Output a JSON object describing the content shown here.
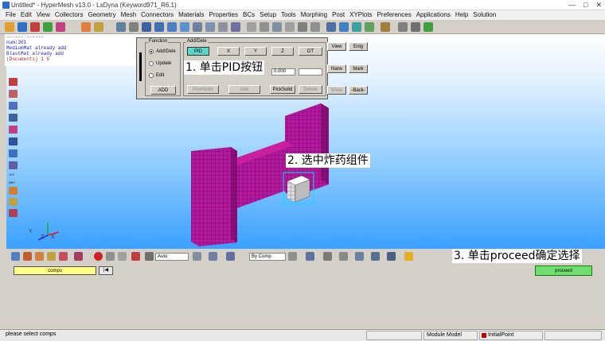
{
  "window": {
    "title": "Untitled* - HyperMesh v13.0 - LsDyna (Keyword971_R6.1)"
  },
  "menu": [
    "File",
    "Edit",
    "View",
    "Collectors",
    "Geometry",
    "Mesh",
    "Connectors",
    "Materials",
    "Properties",
    "BCs",
    "Setup",
    "Tools",
    "Morphing",
    "Post",
    "XYPlots",
    "Preferences",
    "Applications",
    "Help",
    "Solution"
  ],
  "console": {
    "lines": [
      "------  ------",
      "num:301",
      "MediumMat already add",
      "BlastMat already add",
      "(Documents) 1 6"
    ]
  },
  "panel": {
    "function_legend": "Function",
    "radios": [
      {
        "label": "Add/Dele",
        "selected": true
      },
      {
        "label": "Update",
        "selected": false
      },
      {
        "label": "Edit",
        "selected": false
      }
    ],
    "add_button": "ADD",
    "adddele_legend": "Add/Dele",
    "tabs": [
      "PID",
      "X",
      "Y",
      "Z",
      "DT"
    ],
    "active_tab": "PID",
    "value": "0.000",
    "row_buttons": [
      "PickNode",
      "Add",
      "PickSolid",
      "Delete"
    ],
    "right_buttons": [
      "View",
      "Enlg",
      "Narw",
      "Mark",
      "Show",
      "-Back-"
    ]
  },
  "annotations": {
    "step1": "1. 单击PID按钮",
    "step2": "2. 选中炸药组件",
    "step3": "3. 单击proceed确定选择"
  },
  "axis": {
    "y": "Y",
    "z": "Z",
    "x": "X"
  },
  "bottom_toolbar": {
    "auto_combo": "Auto",
    "bycomp_combo": "By Comp"
  },
  "selection": {
    "comps_button": "comps",
    "reset_icon": "|◀",
    "proceed_button": "proceed"
  },
  "status": {
    "message": "please select comps",
    "module": "Module Model",
    "initial_point": "InitialPoint"
  },
  "colors": {
    "mesh_magenta": "#b3189f",
    "selected_component": "#d8d8d8",
    "proceed_green": "#6fe06f",
    "comps_yellow": "#ffff88"
  }
}
